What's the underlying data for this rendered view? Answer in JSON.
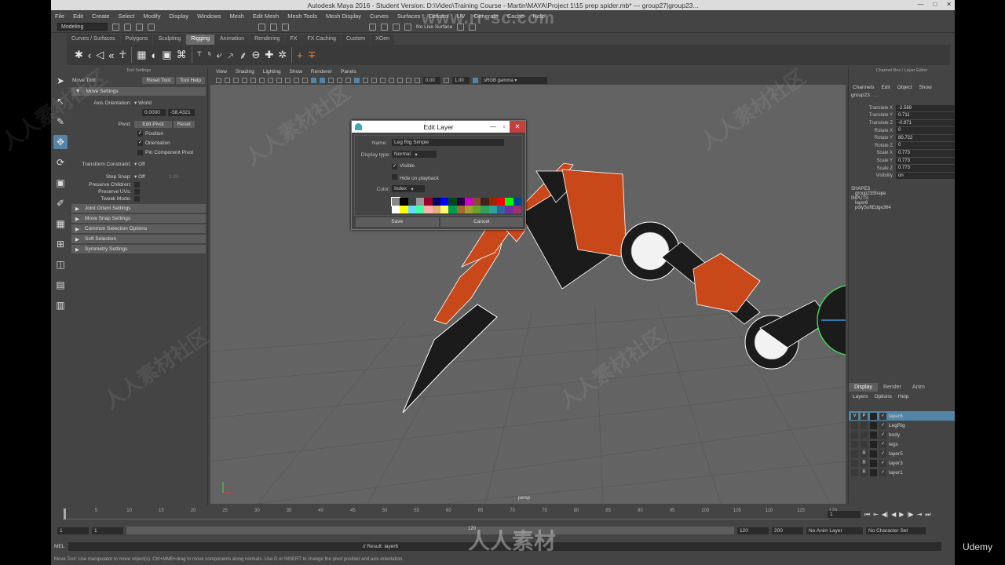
{
  "window": {
    "title": "Autodesk Maya 2016 - Student Version: D:\\Video\\Training Course - Martin\\MAYA\\Project 1\\15 prep spider.mb*   ---   group27|group23...",
    "min": "—",
    "max": "□",
    "close": "✕"
  },
  "menus": [
    "File",
    "Edit",
    "Create",
    "Select",
    "Modify",
    "Display",
    "Windows",
    "Mesh",
    "Edit Mesh",
    "Mesh Tools",
    "Mesh Display",
    "Curves",
    "Surfaces",
    "Deform",
    "UV",
    "Generate",
    "Cache",
    "Help"
  ],
  "status": {
    "mode": "Modeling",
    "live": "No Live Surface"
  },
  "shelf_tabs": [
    "Curves / Surfaces",
    "Polygons",
    "Sculpting",
    "Rigging",
    "Animation",
    "Rendering",
    "FX",
    "FX Caching",
    "Custom",
    "XGen"
  ],
  "shelf_active": "Rigging",
  "shelf_icons": [
    "✱",
    "‹",
    "◁",
    "«",
    "☥",
    "▦",
    "◐",
    "▣",
    "⌘",
    "⸆",
    "⸅",
    "⤶",
    "⸕",
    "⸙",
    "⊖",
    "✚",
    "✲",
    "+",
    "∓"
  ],
  "tool_settings": {
    "header": "Tool Settings",
    "title": "Move Tool",
    "reset": "Reset Tool",
    "help": "Tool Help",
    "section": "Move Settings",
    "axis_label": "Axis Orientation:",
    "axis_value": "World",
    "v1": "0.0000",
    "v2": "-58.4321",
    "pivot_label": "Pivot:",
    "edit_pivot": "Edit Pivot",
    "reset_btn": "Reset",
    "position": "Position",
    "orientation": "Orientation",
    "pin": "Pin Component Pivot",
    "tc_label": "Transform Constraint:",
    "tc_value": "Off",
    "snap_label": "Step Snap:",
    "snap_value": "Off",
    "snap_num": "1.00",
    "pc": "Preserve Children:",
    "puv": "Preserve UVs:",
    "tweak": "Tweak Mode:",
    "sections": [
      "Joint Orient Settings",
      "Move Snap Settings",
      "Common Selection Options",
      "Soft Selection",
      "Symmetry Settings"
    ]
  },
  "viewport": {
    "menus": [
      "View",
      "Shading",
      "Lighting",
      "Show",
      "Renderer",
      "Panels"
    ],
    "n1": "0.00",
    "n2": "1.00",
    "colorspace": "sRGB gamma",
    "camera": "persp"
  },
  "dialog": {
    "title": "Edit Layer",
    "name_label": "Name:",
    "name_value": "Leg Rig Simple",
    "display_label": "Display type:",
    "display_value": "Normal",
    "visible": "Visible",
    "hide": "Hide on playback",
    "color_label": "Color:",
    "color_value": "Index",
    "save": "Save",
    "cancel": "Cancel",
    "colors": [
      "#888888",
      "#000000",
      "#404040",
      "#999999",
      "#9b0029",
      "#000461",
      "#0000ff",
      "#004619",
      "#260043",
      "#c800c8",
      "#8a4833",
      "#3f231f",
      "#992600",
      "#ff0000",
      "#00ff00",
      "#004199",
      "#ffffff",
      "#ffff00",
      "#64dcff",
      "#43ffa3",
      "#ffb0b0",
      "#e4ac79",
      "#ffff63",
      "#009954",
      "#a56a30",
      "#9ea130",
      "#68a130",
      "#30a15d",
      "#30a1a1",
      "#3067a1",
      "#6f30a1",
      "#a1306a"
    ]
  },
  "channel_box": {
    "header": "Channel Box / Layer Editor",
    "menus": [
      "Channels",
      "Edit",
      "Object",
      "Show"
    ],
    "object": "group23 . . .",
    "attrs": [
      {
        "l": "Translate X",
        "v": "-2.589"
      },
      {
        "l": "Translate Y",
        "v": "0.711"
      },
      {
        "l": "Translate Z",
        "v": "-0.971"
      },
      {
        "l": "Rotate X",
        "v": "0"
      },
      {
        "l": "Rotate Y",
        "v": "80.722"
      },
      {
        "l": "Rotate Z",
        "v": "0"
      },
      {
        "l": "Scale X",
        "v": "0.773"
      },
      {
        "l": "Scale Y",
        "v": "0.773"
      },
      {
        "l": "Scale Z",
        "v": "0.773"
      },
      {
        "l": "Visibility",
        "v": "on"
      }
    ],
    "shapes_h": "SHAPES",
    "shape": "group23Shape",
    "inputs_h": "INPUTS",
    "inputs": [
      "layer6",
      "polySoftEdge364"
    ]
  },
  "layers": {
    "tabs": [
      "Display",
      "Render",
      "Anim"
    ],
    "menus": [
      "Layers",
      "Options",
      "Help"
    ],
    "rows": [
      {
        "v": "V",
        "p": "P",
        "name": "layer6"
      },
      {
        "v": "",
        "p": "",
        "name": "LegRig"
      },
      {
        "v": "",
        "p": "",
        "name": "body"
      },
      {
        "v": "",
        "p": "",
        "name": "legs"
      },
      {
        "v": "",
        "p": "R",
        "name": "layer5"
      },
      {
        "v": "",
        "p": "R",
        "name": "layer3"
      },
      {
        "v": "",
        "p": "R",
        "name": "layer1"
      }
    ]
  },
  "time": {
    "ticks": [
      "1",
      "5",
      "10",
      "15",
      "20",
      "25",
      "30",
      "35",
      "40",
      "45",
      "50",
      "55",
      "60",
      "65",
      "70",
      "75",
      "80",
      "85",
      "90",
      "95",
      "100",
      "105",
      "110",
      "115",
      "120"
    ],
    "current": "1",
    "start": "1",
    "start2": "1",
    "end1": "120",
    "end2": "120",
    "end3": "200",
    "anim_layer": "No Anim Layer",
    "char_set": "No Character Set"
  },
  "cmd": {
    "lang": "MEL",
    "result": "// Result: layer6"
  },
  "help": "Move Tool: Use manipulator to move object(s). Ctrl+MMB+drag to move components along normals. Use D or INSERT to change the pivot position and axis orientation.",
  "watermarks": {
    "site": "www.rr-sc.com",
    "brand": "人人素材",
    "udemy": "Udemy",
    "cn": "人人素材社区"
  }
}
